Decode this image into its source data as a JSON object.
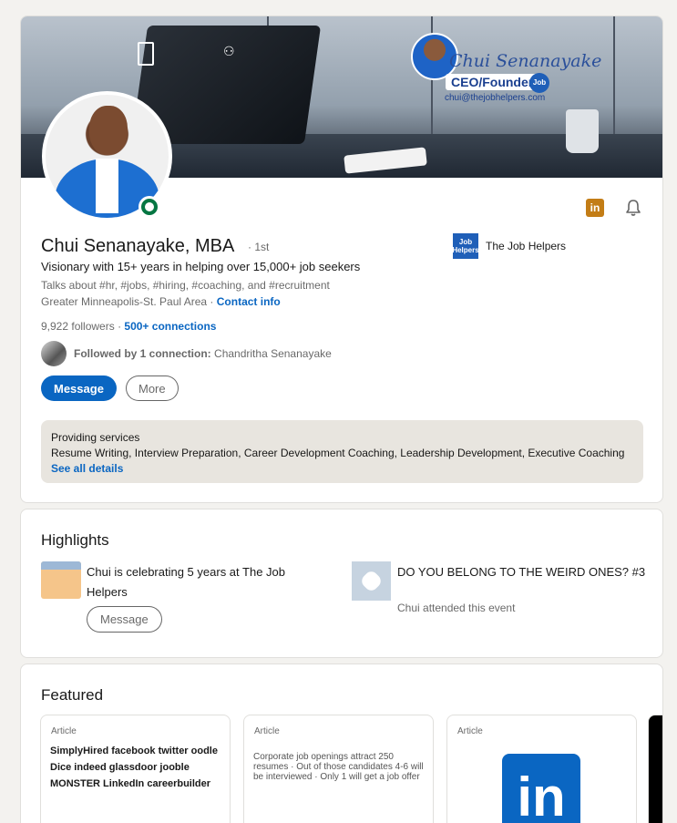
{
  "profile": {
    "name": "Chui Senanayake, MBA",
    "degree": "· 1st",
    "headline": "Visionary with 15+ years in helping over 15,000+ job seekers",
    "talks_about": "Talks about #hr, #jobs, #hiring, #coaching, and #recruitment",
    "location": "Greater Minneapolis-St. Paul Area ·",
    "contact_info": "Contact info",
    "followers": "9,922 followers",
    "connections": "500+ connections",
    "followed_by_prefix": "Followed by 1 connection:",
    "followed_by_name": "Chandritha Senanayake",
    "company": "The Job Helpers",
    "company_logo_text": "Job Helpers",
    "message_button": "Message",
    "more_button": "More",
    "linkedin_badge": "in"
  },
  "banner": {
    "signature": "Chui Senanayake",
    "title": "CEO/Founder",
    "email": "chui@thejobhelpers.com",
    "logo_text": "Job"
  },
  "services": {
    "title": "Providing services",
    "list": "Resume Writing, Interview Preparation, Career Development Coaching, Leadership Development, Executive Coaching",
    "see_all": "See all details"
  },
  "highlights": {
    "title": "Highlights",
    "item1_text": "Chui is celebrating 5 years at The Job Helpers",
    "item1_button": "Message",
    "item2_text": "DO YOU BELONG TO THE WEIRD ONES? #3",
    "item2_sub": "Chui attended this event"
  },
  "featured": {
    "title": "Featured",
    "cards": [
      {
        "label": "Article",
        "preview": "SimplyHired facebook twitter oodle Dice indeed glassdoor jooble MONSTER LinkedIn careerbuilder"
      },
      {
        "label": "Article",
        "preview": "Corporate job openings attract 250 resumes · Out of those candidates 4-6 will be interviewed · Only 1 will get a job offer"
      },
      {
        "label": "Article",
        "preview": "in"
      }
    ]
  },
  "colors": {
    "accent": "#0a66c2",
    "online": "#057642",
    "badge": "#c37d16",
    "background": "#f3f2ef"
  }
}
